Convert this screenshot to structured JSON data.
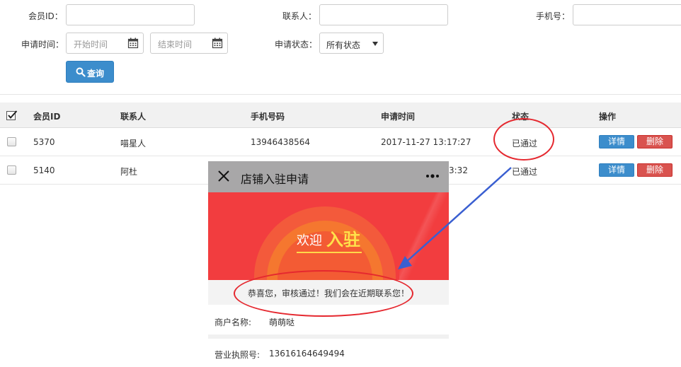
{
  "filters": {
    "member_id_label": "会员ID：",
    "contact_label": "联系人：",
    "phone_label": "手机号：",
    "apply_time_label": "申请时间：",
    "start_placeholder": "开始时间",
    "end_placeholder": "结束时间",
    "status_label": "申请状态：",
    "status_value": "所有状态",
    "query_button": "查询"
  },
  "table": {
    "headers": [
      "会员ID",
      "联系人",
      "手机号码",
      "申请时间",
      "状态",
      "操作"
    ],
    "rows": [
      {
        "member_id": "5370",
        "contact": "喵星人",
        "phone": "13946438564",
        "time": "2017-11-27 13:17:27",
        "status": "已通过",
        "detail": "详情",
        "delete": "删除"
      },
      {
        "member_id": "5140",
        "contact": "阿杜",
        "phone": "",
        "time": "3:32",
        "status": "已通过",
        "detail": "详情",
        "delete": "删除"
      }
    ]
  },
  "phone_popup": {
    "title": "店铺入驻申请",
    "banner_text_1": "欢迎",
    "banner_text_2": "入驻",
    "congrats": "恭喜您，审核通过！我们会在近期联系您！",
    "merchant_name_label": "商户名称:",
    "merchant_name_value": "萌萌哒",
    "license_label": "营业执照号:",
    "license_value": "13616164649494"
  },
  "colors": {
    "primary": "#3c8dcc",
    "danger": "#d9534f",
    "annotation": "#e5282f",
    "arrow": "#3a5fd1",
    "banner": "#f23d3f"
  },
  "icons": {
    "query": "search-icon",
    "calendar": "calendar-icon",
    "close": "close-icon",
    "more": "more-icon"
  }
}
